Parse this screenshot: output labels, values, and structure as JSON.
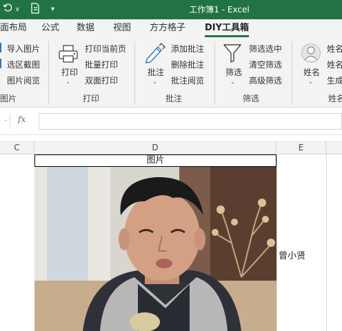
{
  "window": {
    "title": "工作簿1  -  Excel",
    "quick_access": {
      "undo_icon": "undo-icon",
      "redo_icon": "redo-icon",
      "save_icon": "file-icon",
      "customize_icon": "customize-qat-icon"
    }
  },
  "tabs": [
    {
      "label": "页面布局",
      "visible_label": "面布局"
    },
    {
      "label": "公式"
    },
    {
      "label": "数据"
    },
    {
      "label": "视图"
    },
    {
      "label": "方方格子"
    },
    {
      "label": "DIY工具箱",
      "active": true
    }
  ],
  "ribbon": {
    "groups": [
      {
        "label": "图片",
        "items": [
          "导入图片",
          "选区截图",
          "图片阅览"
        ]
      },
      {
        "label": "打印",
        "big_button": "打印",
        "items": [
          "打印当前页",
          "批量打印",
          "双面打印"
        ]
      },
      {
        "label": "批注",
        "big_button": "批注",
        "items": [
          "添加批注",
          "删除批注",
          "批注阅览"
        ]
      },
      {
        "label": "筛选",
        "big_button": "筛选",
        "items": [
          "筛选选中",
          "清空筛选",
          "高级筛选"
        ]
      },
      {
        "label": "姓名",
        "big_button": "姓名",
        "items": [
          "姓名",
          "姓名",
          "生成"
        ]
      }
    ]
  },
  "formula_bar": {
    "fx_label": "fx",
    "value": ""
  },
  "columns": [
    "C",
    "D",
    "E"
  ],
  "sheet": {
    "header_cell": "图片",
    "name_cell": "曾小贤"
  },
  "colors": {
    "accent": "#217346",
    "ribbon_bg": "#f3f3f3"
  }
}
